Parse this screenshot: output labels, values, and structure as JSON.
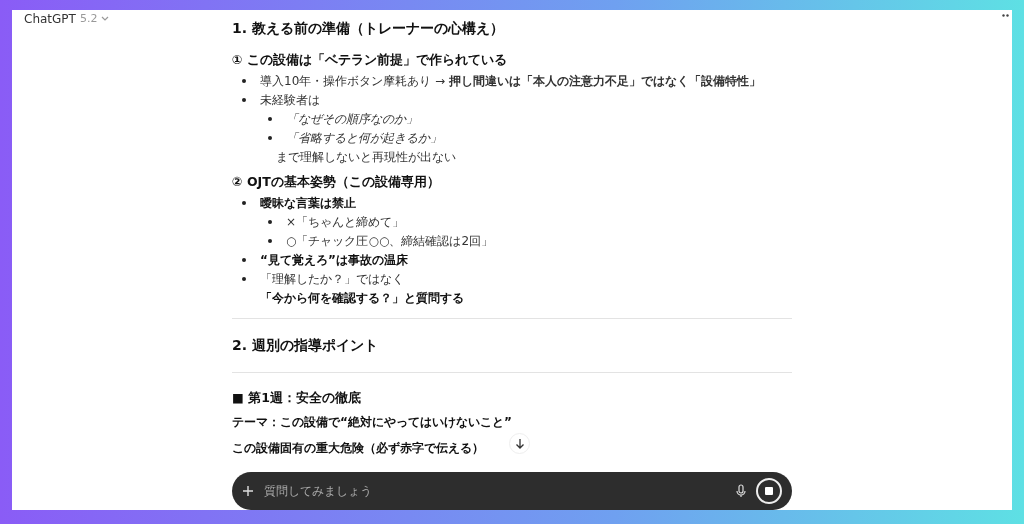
{
  "header": {
    "title": "ChatGPT",
    "version": "5.2"
  },
  "blocks": [
    {
      "kind": "h2",
      "text": "1. 教える前の準備（トレーナーの心構え）"
    },
    {
      "kind": "h3",
      "text": "① この設備は「ベテラン前提」で作られている"
    },
    {
      "kind": "list",
      "items": [
        {
          "text": "導入10年・操作ボタン摩耗あり → **押し間違いは「本人の注意力不足」ではなく「設備特性」**",
          "bold": false,
          "italic": false
        },
        {
          "text": "未経験者は",
          "bold": false,
          "italic": false,
          "children": [
            {
              "text": "「なぜその順序なのか」",
              "bold": false,
              "italic": true
            },
            {
              "text": "「省略すると何が起きるか」",
              "bold": false,
              "italic": true
            }
          ],
          "note": {
            "text": "まで理解しないと再現性が出ない",
            "bold": false
          }
        }
      ]
    },
    {
      "kind": "h3",
      "text": "② OJTの基本姿勢（この設備専用）"
    },
    {
      "kind": "list",
      "items": [
        {
          "text": "曖昧な言葉は禁止",
          "bold": true,
          "italic": false,
          "children": [
            {
              "text": "×「ちゃんと締めて」",
              "bold": false,
              "italic": false
            },
            {
              "text": "○「チャック圧○○、締結確認は2回」",
              "bold": false,
              "italic": false
            }
          ]
        },
        {
          "text": "“見て覚えろ”は事故の温床",
          "bold": true,
          "italic": false
        },
        {
          "text": "「理解したか？」ではなく",
          "bold": false,
          "italic": false,
          "note": {
            "text": "「今から何を確認する？」と質問する",
            "bold": true
          }
        }
      ]
    },
    {
      "kind": "divider"
    },
    {
      "kind": "h2",
      "text": "2. 週別の指導ポイント"
    },
    {
      "kind": "divider"
    },
    {
      "kind": "h3",
      "text": "■ 第1週：安全の徹底"
    },
    {
      "kind": "para",
      "text": "テーマ：この設備で“絶対にやってはいけないこと”"
    },
    {
      "kind": "para",
      "text": "この設備固有の重大危険（必ず赤字で伝える）"
    }
  ],
  "composer": {
    "placeholder": "質問してみましょう"
  }
}
